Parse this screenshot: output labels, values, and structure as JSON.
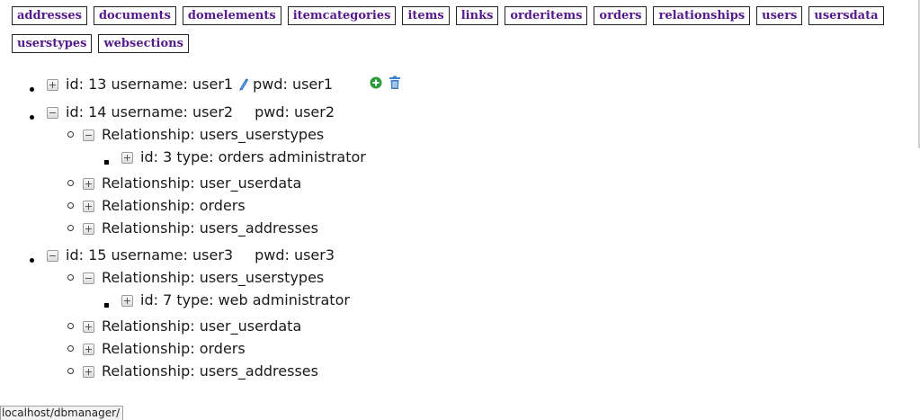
{
  "nav": {
    "links": [
      "addresses",
      "documents",
      "domelements",
      "itemcategories",
      "items",
      "links",
      "orderitems",
      "orders",
      "relationships",
      "users",
      "usersdata",
      "userstypes",
      "websections"
    ]
  },
  "users": [
    {
      "line": "id: 13 username: user1",
      "pwd": "pwd: user1",
      "expanded": false
    },
    {
      "line": "id: 14 username: user2",
      "pwd": "pwd: user2",
      "expanded": true,
      "relationships": [
        {
          "label": "Relationship: users_userstypes",
          "expanded": true,
          "children": [
            "id: 3 type: orders administrator"
          ]
        },
        {
          "label": "Relationship: user_userdata",
          "expanded": false
        },
        {
          "label": "Relationship: orders",
          "expanded": false
        },
        {
          "label": "Relationship: users_addresses",
          "expanded": false
        }
      ]
    },
    {
      "line": "id: 15 username: user3",
      "pwd": "pwd: user3",
      "expanded": true,
      "relationships": [
        {
          "label": "Relationship: users_userstypes",
          "expanded": true,
          "children": [
            "id: 7 type: web administrator"
          ]
        },
        {
          "label": "Relationship: user_userdata",
          "expanded": false
        },
        {
          "label": "Relationship: orders",
          "expanded": false
        },
        {
          "label": "Relationship: users_addresses",
          "expanded": false
        }
      ]
    }
  ],
  "icons": {
    "edit": "pencil-icon",
    "add": "plus-circle-icon",
    "delete": "trash-icon"
  },
  "colors": {
    "link": "#551a8b",
    "add": "#2e9b3a",
    "delete": "#3c7fd0",
    "edit": "#3c7fd0"
  },
  "statusbar": "localhost/dbmanager/"
}
